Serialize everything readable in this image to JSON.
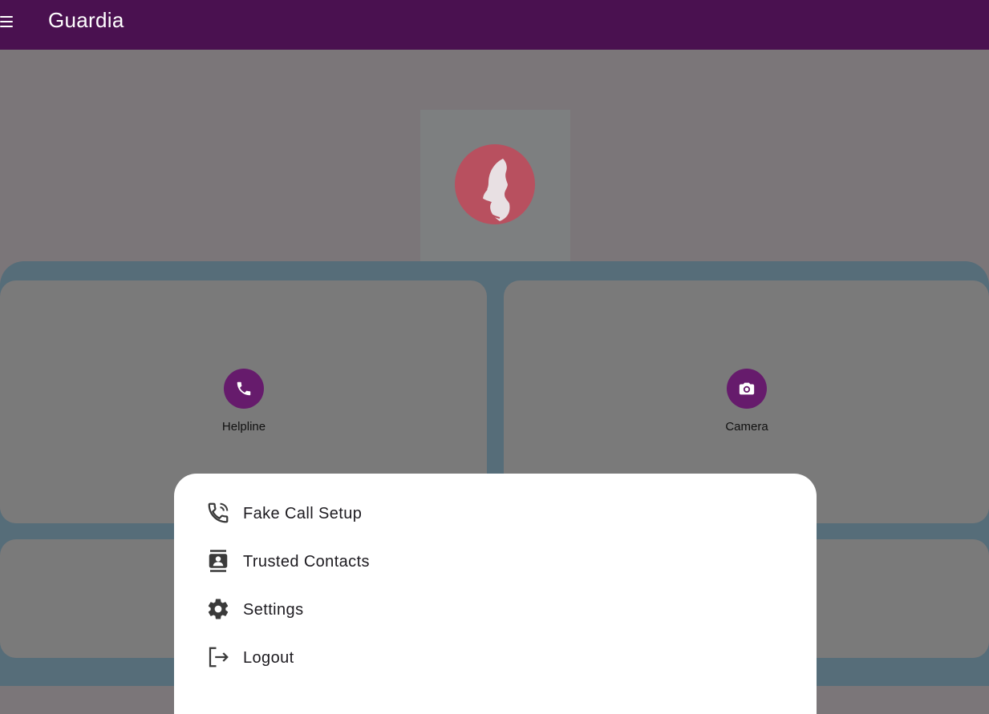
{
  "app": {
    "title": "Guardia"
  },
  "colors": {
    "appbar": "#4a1150",
    "accent": "#661b6c",
    "logo": "#b8505f",
    "sheet": "#ffffff"
  },
  "icons": {
    "menu": "menu-icon",
    "logo": "woman-profile-icon"
  },
  "cards": [
    {
      "label": "Helpline",
      "icon": "phone-icon"
    },
    {
      "label": "Camera",
      "icon": "camera-icon"
    }
  ],
  "menu": {
    "items": [
      {
        "label": "Fake Call Setup",
        "icon": "phone-callback-icon"
      },
      {
        "label": "Trusted Contacts",
        "icon": "contacts-icon"
      },
      {
        "label": "Settings",
        "icon": "gear-icon"
      },
      {
        "label": "Logout",
        "icon": "logout-icon"
      }
    ]
  }
}
